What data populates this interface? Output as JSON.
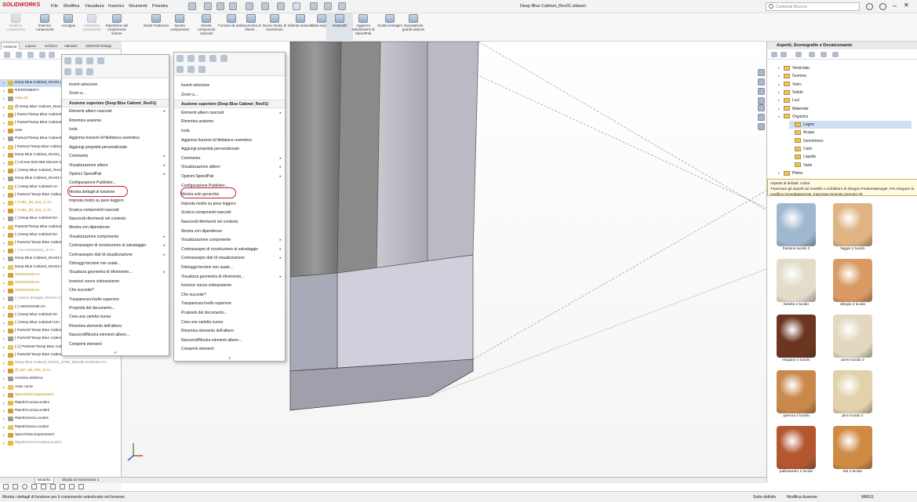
{
  "app": {
    "logo": "SOLIDWORKS",
    "doc_title": "Deep Blue Cabinet_Rev01.sldasm",
    "search_placeholder": "Contenuti Ricerca"
  },
  "menubar": [
    "File",
    "Modifica",
    "Visualizza",
    "Inserisci",
    "Strumenti",
    "Finestra"
  ],
  "ribbon": [
    {
      "label": "Modifica componente",
      "state": "dim"
    },
    {
      "label": "Inserisci componenti",
      "state": "normal"
    },
    {
      "label": "Accoppia",
      "state": "normal"
    },
    {
      "label": "Anteprima componente",
      "state": "dim"
    },
    {
      "label": "Ripetizione del componente lineare",
      "state": "normal"
    },
    {
      "label": "Smart Fasteners",
      "state": "normal"
    },
    {
      "label": "Sposta componente",
      "state": "normal"
    },
    {
      "label": "Mostra componenti nascosti",
      "state": "normal"
    },
    {
      "label": "Funzioni di assi...",
      "state": "normal"
    },
    {
      "label": "Geometria di riferim...",
      "state": "normal"
    },
    {
      "label": "Nuovo studio di movimento",
      "state": "normal"
    },
    {
      "label": "Distinta materiali",
      "state": "normal"
    },
    {
      "label": "Vista esplosa",
      "state": "normal"
    },
    {
      "label": "Instant3D",
      "state": "active"
    },
    {
      "label": "Aggiorna sottoassiemi di SpeedPak",
      "state": "normal"
    },
    {
      "label": "Scatta immagini",
      "state": "normal"
    },
    {
      "label": "Impostazioni grandi assiemi",
      "state": "normal"
    }
  ],
  "left_tabs": [
    "Assieme",
    "Layout",
    "Schizzo",
    "Valutare",
    "SWOOD Design"
  ],
  "tree": [
    {
      "t": "Deep Blue Cabinet_Rev01 (Default<Display State-1>)",
      "s": "sel"
    },
    {
      "t": "RIFERIMENTI"
    },
    {
      "t": "vista 2d",
      "s": "yl"
    },
    {
      "t": "(f) Deep Blue Cabinet_Rev01_top<1>"
    },
    {
      "t": "[ Parte1^Deep Blue Cabinet ]<1>"
    },
    {
      "t": "[ Parte9^Deep Blue Cabinet ]<1>"
    },
    {
      "t": "ante"
    },
    {
      "t": "Parte10^Deep Blue Cabinet<1>"
    },
    {
      "t": "[ Parte11^Deep Blue Cabinet ]<1>"
    },
    {
      "t": "Deep Blue Cabinet_Rev01_box<1>"
    },
    {
      "t": "(-) Screw DIN 965 M4x10<1>"
    },
    {
      "t": "(-) Deep Blue Cabinet_Rev01<2>"
    },
    {
      "t": "Deep Blue Cabinet_Rev01<3>"
    },
    {
      "t": "(-) Deep Blue Cabinet<4>"
    },
    {
      "t": "[ Parte21^Deep Blue Cabinet ]<1>"
    },
    {
      "t": "(-) H51_08_012_1<1>",
      "s": "yl"
    },
    {
      "t": "(-) H51_08_012_1<2>",
      "s": "yl"
    },
    {
      "t": "(-) Deep Blue Cabinet<5>"
    },
    {
      "t": "Parte30^Deep Blue Cabinet<1>"
    },
    {
      "t": "(-) Deep Blue Cabinet<6>"
    },
    {
      "t": "[ Parte31^Deep Blue Cabinet ]<1>"
    },
    {
      "t": "(-) ss mechanism_2<1>",
      "s": "gr"
    },
    {
      "t": "Deep Blue Cabinet_Rev01<7>"
    },
    {
      "t": "Deep Blue Cabinet_Rev01<8>"
    },
    {
      "t": "333201018<1>",
      "s": "yl"
    },
    {
      "t": "333201018<2>",
      "s": "yl"
    },
    {
      "t": "333201018<3>",
      "s": "yl"
    },
    {
      "t": "(-) perno bottiglia_Rev01<1>",
      "s": "gr"
    },
    {
      "t": "(-) VERSIONE<2>"
    },
    {
      "t": "(-) Deep Blue Cabinet<9>"
    },
    {
      "t": "(-) Deep Blue Cabinet<10>"
    },
    {
      "t": "[ Parte32^Deep Blue Cabinet ]<1>"
    },
    {
      "t": "[ Parte33^Deep Blue Cabinet ]<1>"
    },
    {
      "t": "(-) [ Parte34^Deep Blue Cabinet ]<1>"
    },
    {
      "t": "[ Parte35^Deep Blue Cabinet_Rev01 ]<1> (Default<<Default>_Phot..."
    },
    {
      "t": "Deep Blue Cabinet_Rev01_6780_laterale sx/destro<1>",
      "s": "gr"
    },
    {
      "t": "(f) 237_59_000_2<1>",
      "s": "yl"
    },
    {
      "t": "cerniera elettrica"
    },
    {
      "t": "Ante curve"
    },
    {
      "t": "SpecchiaComponente1",
      "s": "yl"
    },
    {
      "t": "RipetizCurvaLocale1"
    },
    {
      "t": "RipetizCurvaLocale2"
    },
    {
      "t": "RipetizioneLLocale1"
    },
    {
      "t": "RipetizioneLLocale2"
    },
    {
      "t": "SpecchiaComponente3"
    },
    {
      "t": "RipetizioneCircolareLocale1",
      "s": "gr"
    }
  ],
  "menu1": {
    "items": [
      {
        "t": "Inverti selezione"
      },
      {
        "t": "Zoom a..."
      },
      {
        "t": "Assieme superiore (Deep Blue Cabinet_Rev01)",
        "h": 1
      },
      {
        "t": "Elementi albero nascosti",
        "a": 1
      },
      {
        "t": "Rinomina assieme"
      },
      {
        "t": "Isola"
      },
      {
        "t": "Aggiorna funzioni di filettatura cosmetica"
      },
      {
        "t": "Aggiungi proprietà personalizzate"
      },
      {
        "t": "Commento",
        "a": 1
      },
      {
        "t": "Visualizzazione albero",
        "a": 1
      },
      {
        "t": "Opzioni SpeedPak",
        "a": 1
      },
      {
        "t": "Configurazione Publisher..."
      },
      {
        "t": "Mostra dettagli di funzione",
        "c": 1
      },
      {
        "t": "Imposta risolto su peso leggero"
      },
      {
        "t": "Scarica componenti nascosti"
      },
      {
        "t": "Nascondi riferimenti nel contesto"
      },
      {
        "t": "Mostra con dipendenze"
      },
      {
        "t": "Visualizzazione componente",
        "a": 1
      },
      {
        "t": "Contrassegno di ricostruzione al salvataggio",
        "a": 1
      },
      {
        "t": "Contrassegno dati di visualizzazione",
        "a": 1
      },
      {
        "t": "Distruggi funzioni non usate..."
      },
      {
        "t": "Visualizza geometria di riferimento...",
        "a": 1
      },
      {
        "t": "Inserisci nuovo sottoassieme"
      },
      {
        "t": "Che succede?"
      },
      {
        "t": "Trasparenza livello superiore"
      },
      {
        "t": "Proprietà del documento..."
      },
      {
        "t": "Crea una cartella nuova"
      },
      {
        "t": "Rinomina elemento dell'albero"
      },
      {
        "t": "Nascondi/Mostra elementi albero..."
      },
      {
        "t": "Comprimi elementi"
      },
      {
        "t": "»"
      }
    ]
  },
  "menu2": {
    "items": [
      {
        "t": "Inverti selezione"
      },
      {
        "t": "Zoom a..."
      },
      {
        "t": "Assieme superiore (Deep Blue Cabinet_Rev01)",
        "h": 1
      },
      {
        "t": "Elementi albero nascosti",
        "a": 1
      },
      {
        "t": "Rinomina assieme"
      },
      {
        "t": "Isola"
      },
      {
        "t": "Aggiorna funzioni di filettatura cosmetica"
      },
      {
        "t": "Aggiungi proprietà personalizzate"
      },
      {
        "t": "Commento",
        "a": 1
      },
      {
        "t": "Visualizzazione albero",
        "a": 1
      },
      {
        "t": "Opzioni SpeedPak",
        "a": 1
      },
      {
        "t": "Configurazione Publisher..."
      },
      {
        "t": "Mostra solo gerarchia",
        "c": 1
      },
      {
        "t": "Imposta risolto su peso leggero"
      },
      {
        "t": "Scarica componenti nascosti"
      },
      {
        "t": "Nascondi riferimenti nel contesto"
      },
      {
        "t": "Mostra con dipendenze"
      },
      {
        "t": "Visualizzazione componente",
        "a": 1
      },
      {
        "t": "Contrassegno di ricostruzione al salvataggio",
        "a": 1
      },
      {
        "t": "Contrassegno dati di visualizzazione",
        "a": 1
      },
      {
        "t": "Distruggi funzioni non usate..."
      },
      {
        "t": "Visualizza geometria di riferimento...",
        "a": 1
      },
      {
        "t": "Inserisci nuovo sottoassieme"
      },
      {
        "t": "Che succede?"
      },
      {
        "t": "Trasparenza livello superiore"
      },
      {
        "t": "Proprietà del documento..."
      },
      {
        "t": "Crea una cartella nuova"
      },
      {
        "t": "Rinomina elemento dell'albero"
      },
      {
        "t": "Nascondi/Mostra elementi albero..."
      },
      {
        "t": "Comprimi elementi"
      },
      {
        "t": "»"
      }
    ]
  },
  "right": {
    "title": "Aspetti, Scenografie e Decalcomanie",
    "tree": [
      {
        "t": "Verniciato",
        "d": 1
      },
      {
        "t": "Gomma",
        "d": 1
      },
      {
        "t": "Vetro",
        "d": 1
      },
      {
        "t": "Solido",
        "d": 1
      },
      {
        "t": "Luci",
        "d": 1
      },
      {
        "t": "Materiale",
        "d": 1
      },
      {
        "t": "Organico",
        "d": 1,
        "open": 1
      },
      {
        "t": "Legno",
        "d": 2,
        "sel": 1
      },
      {
        "t": "Acqua",
        "d": 2
      },
      {
        "t": "Gemstones",
        "d": 2
      },
      {
        "t": "Cielo",
        "d": 2
      },
      {
        "t": "Liquido",
        "d": 2
      },
      {
        "t": "Varie",
        "d": 2
      },
      {
        "t": "Pietra",
        "d": 1
      }
    ],
    "tooltip_title": "Aspetto di default: colore",
    "tooltip_text": "Trascinare gli aspetti sul modello o sull'albero di disegno FeatureManager. Per eseguire la modifica immediatamente, trascinare tenendo premuto Alt.",
    "swatches": [
      {
        "label": "frassino lucido 2",
        "color": "#9fb8cf"
      },
      {
        "label": "faggio 2 lucido",
        "color": "#e0b383"
      },
      {
        "label": "betulla 2 lucido",
        "color": "#e4dccb"
      },
      {
        "label": "ciliegio 2 lucido",
        "color": "#d99a63"
      },
      {
        "label": "mogano 2 lucido",
        "color": "#6b3520"
      },
      {
        "label": "acero lucido 2",
        "color": "#e3d8bf"
      },
      {
        "label": "quercia 2 lucido",
        "color": "#c8894b"
      },
      {
        "label": "pino lucido 2",
        "color": "#e2d2ab"
      },
      {
        "label": "palissandro 2 lucido",
        "color": "#b45630"
      },
      {
        "label": "tek 2 lucido",
        "color": "#cf8a44"
      }
    ]
  },
  "bottom_tabs": [
    "",
    "Modello",
    "Studio di movimento 1"
  ],
  "status": {
    "message": "Mostra i dettagli di funzione per il componente selezionato nel browser.",
    "s1": "Sotto definito",
    "s2": "Modifica Assieme",
    "s3": "MMGS"
  }
}
